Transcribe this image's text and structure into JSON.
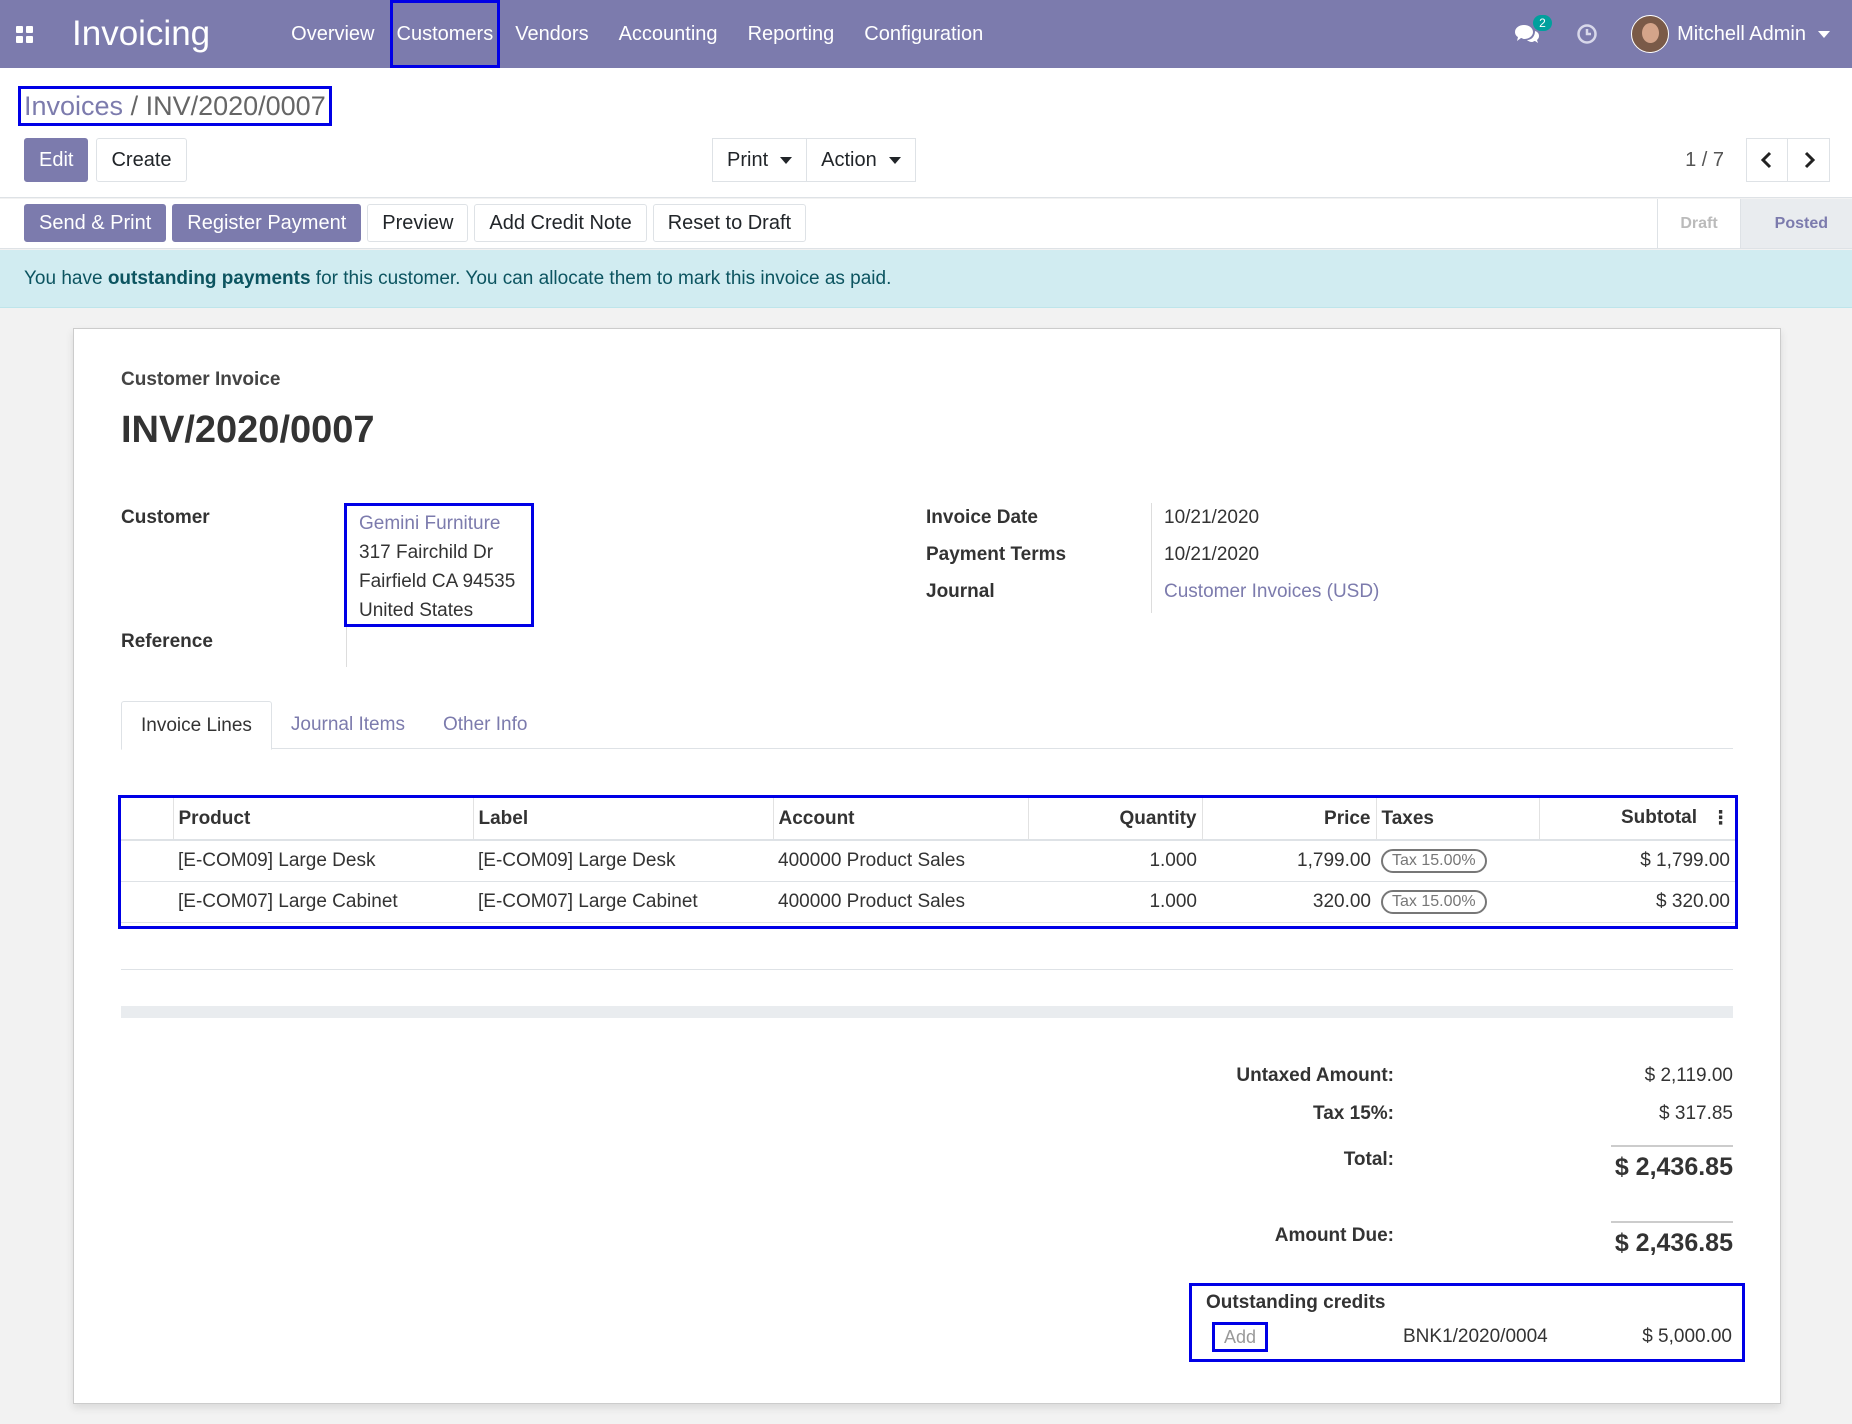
{
  "nav": {
    "brand": "Invoicing",
    "menu": [
      "Overview",
      "Customers",
      "Vendors",
      "Accounting",
      "Reporting",
      "Configuration"
    ],
    "chat_count": "2",
    "user_name": "Mitchell Admin"
  },
  "breadcrumb": {
    "parent": "Invoices",
    "separator": " / ",
    "current": "INV/2020/0007"
  },
  "control": {
    "edit": "Edit",
    "create": "Create",
    "print": "Print",
    "action": "Action",
    "pager": "1 / 7"
  },
  "status": {
    "buttons": [
      "Send & Print",
      "Register Payment",
      "Preview",
      "Add Credit Note",
      "Reset to Draft"
    ],
    "stages": [
      "Draft",
      "Posted"
    ],
    "active_stage": "Posted"
  },
  "alert": {
    "prefix": "You have ",
    "bold": "outstanding payments",
    "suffix": " for this customer. You can allocate them to mark this invoice as paid."
  },
  "invoice": {
    "type": "Customer Invoice",
    "number": "INV/2020/0007",
    "customer_label": "Customer",
    "customer_name": "Gemini Furniture",
    "address": [
      "317 Fairchild Dr",
      "Fairfield CA 94535",
      "United States"
    ],
    "reference_label": "Reference",
    "invoice_date_label": "Invoice Date",
    "invoice_date": "10/21/2020",
    "payment_terms_label": "Payment Terms",
    "payment_terms": "10/21/2020",
    "journal_label": "Journal",
    "journal": "Customer Invoices (USD)"
  },
  "tabs": [
    "Invoice Lines",
    "Journal Items",
    "Other Info"
  ],
  "lines": {
    "headers": [
      "Product",
      "Label",
      "Account",
      "Quantity",
      "Price",
      "Taxes",
      "Subtotal"
    ],
    "rows": [
      {
        "product": "[E-COM09] Large Desk",
        "label": "[E-COM09] Large Desk",
        "account": "400000 Product Sales",
        "quantity": "1.000",
        "price": "1,799.00",
        "tax": "Tax 15.00%",
        "subtotal": "$ 1,799.00"
      },
      {
        "product": "[E-COM07] Large Cabinet",
        "label": "[E-COM07] Large Cabinet",
        "account": "400000 Product Sales",
        "quantity": "1.000",
        "price": "320.00",
        "tax": "Tax 15.00%",
        "subtotal": "$ 320.00"
      }
    ]
  },
  "totals": {
    "untaxed_label": "Untaxed Amount:",
    "untaxed": "$ 2,119.00",
    "tax_label": "Tax 15%:",
    "tax": "$ 317.85",
    "total_label": "Total:",
    "total": "$ 2,436.85",
    "due_label": "Amount Due:",
    "due": "$ 2,436.85"
  },
  "credits": {
    "title": "Outstanding credits",
    "add": "Add",
    "ref": "BNK1/2020/0004",
    "amount": "$ 5,000.00"
  },
  "colors": {
    "brand": "#7c7bad",
    "highlight_box": "#0000e6",
    "alert_bg": "#d1ecf1"
  }
}
